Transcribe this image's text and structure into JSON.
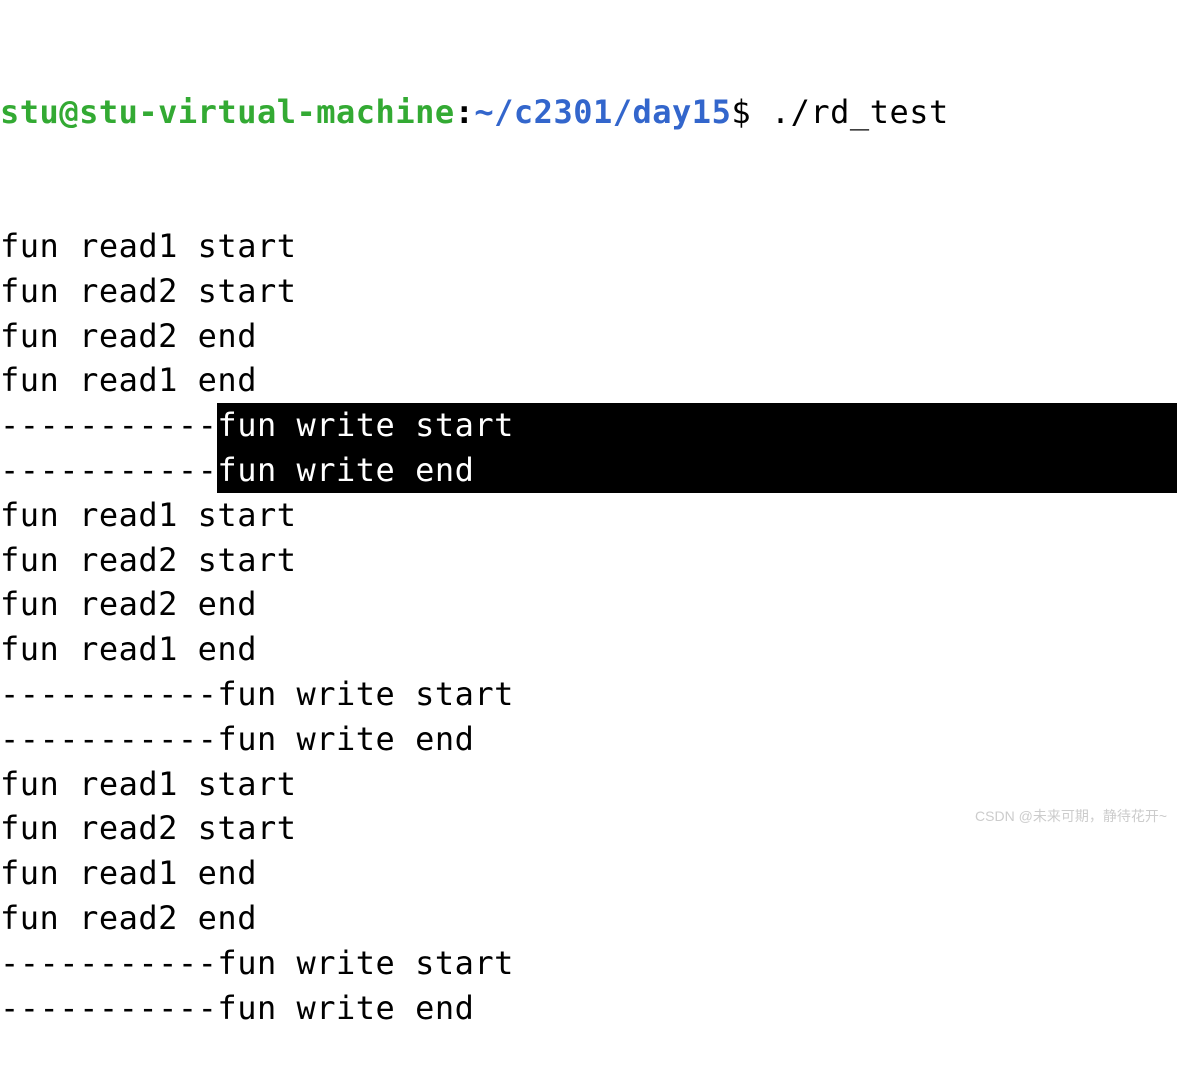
{
  "prompt": {
    "user_host": "stu@stu-virtual-machine",
    "colon": ":",
    "path": "~/c2301/day15",
    "dollar": "$ ",
    "command": "./rd_test"
  },
  "lines": [
    {
      "text": "fun read1 start",
      "highlighted": false,
      "prefix": ""
    },
    {
      "text": "fun read2 start",
      "highlighted": false,
      "prefix": ""
    },
    {
      "text": "fun read2 end",
      "highlighted": false,
      "prefix": ""
    },
    {
      "text": "fun read1 end",
      "highlighted": false,
      "prefix": ""
    },
    {
      "text": "fun write start",
      "highlighted": true,
      "prefix": "-----------"
    },
    {
      "text": "fun write end",
      "highlighted": true,
      "prefix": "-----------"
    },
    {
      "text": "fun read1 start",
      "highlighted": false,
      "prefix": ""
    },
    {
      "text": "fun read2 start",
      "highlighted": false,
      "prefix": ""
    },
    {
      "text": "fun read2 end",
      "highlighted": false,
      "prefix": ""
    },
    {
      "text": "fun read1 end",
      "highlighted": false,
      "prefix": ""
    },
    {
      "text": "-----------fun write start",
      "highlighted": false,
      "prefix": ""
    },
    {
      "text": "-----------fun write end",
      "highlighted": false,
      "prefix": ""
    },
    {
      "text": "fun read1 start",
      "highlighted": false,
      "prefix": ""
    },
    {
      "text": "fun read2 start",
      "highlighted": false,
      "prefix": ""
    },
    {
      "text": "fun read1 end",
      "highlighted": false,
      "prefix": ""
    },
    {
      "text": "fun read2 end",
      "highlighted": false,
      "prefix": ""
    },
    {
      "text": "-----------fun write start",
      "highlighted": false,
      "prefix": ""
    },
    {
      "text": "-----------fun write end",
      "highlighted": false,
      "prefix": ""
    }
  ],
  "watermark": "CSDN @未来可期，静待花开~"
}
